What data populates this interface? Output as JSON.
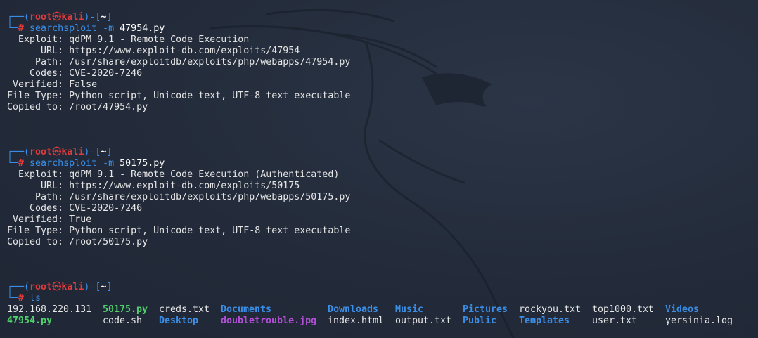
{
  "prompt": {
    "frame_top": "┌──(",
    "user": "root",
    "skull": "㉿",
    "host": "kali",
    "frame_mid": ")-[",
    "dir": "~",
    "frame_end": "]",
    "frame_bottom": "└─",
    "hash": "#"
  },
  "commands": [
    {
      "cmd": "searchsploit",
      "flag": "-m",
      "arg": "47954.py",
      "output": [
        {
          "label": "  Exploit:",
          "value": " qdPM 9.1 - Remote Code Execution"
        },
        {
          "label": "      URL:",
          "value": " https://www.exploit-db.com/exploits/47954"
        },
        {
          "label": "     Path:",
          "value": " /usr/share/exploitdb/exploits/php/webapps/47954.py"
        },
        {
          "label": "    Codes:",
          "value": " CVE-2020-7246"
        },
        {
          "label": " Verified:",
          "value": " False"
        },
        {
          "label": "File Type:",
          "value": " Python script, Unicode text, UTF-8 text executable"
        },
        {
          "label": "Copied to:",
          "value": " /root/47954.py"
        }
      ]
    },
    {
      "cmd": "searchsploit",
      "flag": "-m",
      "arg": "50175.py",
      "output": [
        {
          "label": "  Exploit:",
          "value": " qdPM 9.1 - Remote Code Execution (Authenticated)"
        },
        {
          "label": "      URL:",
          "value": " https://www.exploit-db.com/exploits/50175"
        },
        {
          "label": "     Path:",
          "value": " /usr/share/exploitdb/exploits/php/webapps/50175.py"
        },
        {
          "label": "    Codes:",
          "value": " CVE-2020-7246"
        },
        {
          "label": " Verified:",
          "value": " True"
        },
        {
          "label": "File Type:",
          "value": " Python script, Unicode text, UTF-8 text executable"
        },
        {
          "label": "Copied to:",
          "value": " /root/50175.py"
        }
      ]
    }
  ],
  "ls": {
    "cmd": "ls",
    "row1": [
      {
        "name": "192.168.220.131",
        "kind": "plain"
      },
      {
        "name": "50175.py",
        "kind": "exec"
      },
      {
        "name": "creds.txt",
        "kind": "plain"
      },
      {
        "name": "Documents",
        "kind": "dir"
      },
      {
        "name": "Downloads",
        "kind": "dir"
      },
      {
        "name": "Music",
        "kind": "dir"
      },
      {
        "name": "Pictures",
        "kind": "dir"
      },
      {
        "name": "rockyou.txt",
        "kind": "plain"
      },
      {
        "name": "top1000.txt",
        "kind": "plain"
      },
      {
        "name": "Videos",
        "kind": "dir"
      }
    ],
    "row2": [
      {
        "name": "47954.py",
        "kind": "exec"
      },
      {
        "name": "code.sh",
        "kind": "plain"
      },
      {
        "name": "Desktop",
        "kind": "dir"
      },
      {
        "name": "doubletrouble.jpg",
        "kind": "img"
      },
      {
        "name": "index.html",
        "kind": "plain"
      },
      {
        "name": "output.txt",
        "kind": "plain"
      },
      {
        "name": "Public",
        "kind": "dir"
      },
      {
        "name": "Templates",
        "kind": "dir"
      },
      {
        "name": "user.txt",
        "kind": "plain"
      },
      {
        "name": "yersinia.log",
        "kind": "plain"
      }
    ]
  },
  "colors": {
    "background": "#232b3a",
    "prompt_frame": "#3a8ee6",
    "prompt_user": "#e33a3a",
    "dir": "#3a8ee6",
    "exec": "#4fd16b",
    "image": "#b24fd6",
    "text": "#e6e6e6"
  },
  "icons": {
    "background": "kali-dragon-icon"
  }
}
